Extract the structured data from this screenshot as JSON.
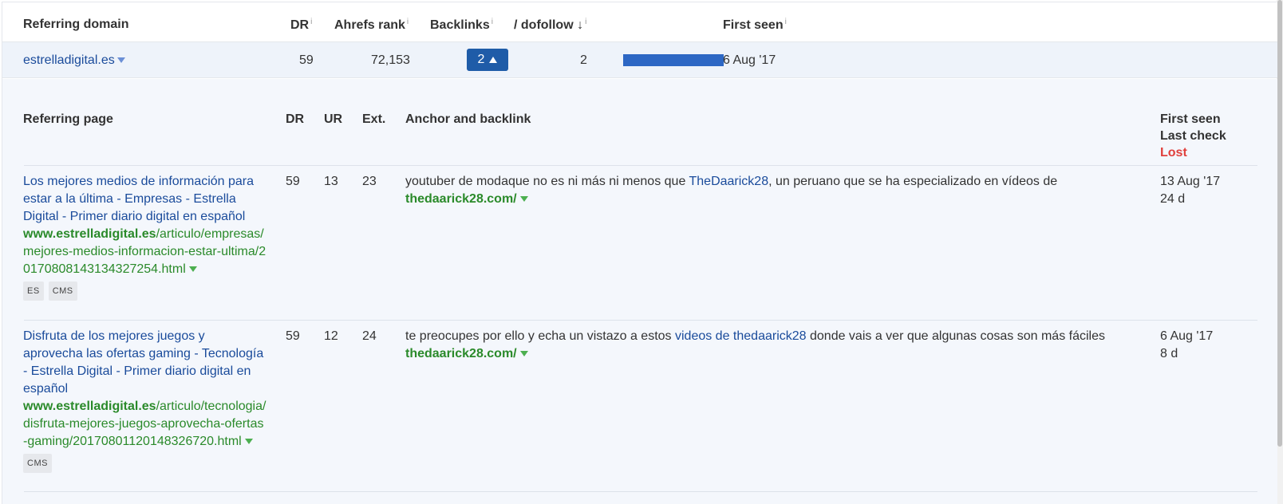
{
  "header": {
    "referring_domain": "Referring domain",
    "dr": "DR",
    "ahrefs_rank": "Ahrefs rank",
    "backlinks": "Backlinks",
    "dofollow": "/ dofollow",
    "dofollow_sort": "↓",
    "first_seen": "First seen",
    "info": "i"
  },
  "domain_row": {
    "domain": "estrelladigital.es",
    "dr": "59",
    "ahrefs_rank": "72,153",
    "backlinks": "2",
    "dofollow": "2",
    "dofollow_bar_fraction": 1.0,
    "first_seen": "6 Aug '17"
  },
  "detail_header": {
    "referring_page": "Referring page",
    "dr": "DR",
    "ur": "UR",
    "ext": "Ext.",
    "anchor": "Anchor and backlink",
    "first_seen": "First seen",
    "last_check": "Last check",
    "lost": "Lost"
  },
  "rows": [
    {
      "title": "Los mejores medios de información para estar a la última - Empresas - Estrella Digital - Primer diario digital en español",
      "url_domain": "www.estrelladigital.es",
      "url_path": "/articulo/empresas/mejores-medios-informacion-estar-ultima/20170808143134327254.html",
      "tags": [
        "ES",
        "CMS"
      ],
      "dr": "59",
      "ur": "13",
      "ext": "23",
      "anchor_before": "youtuber de modaque no es ni más ni menos que ",
      "anchor_link": "TheDaarick28",
      "anchor_after": ", un peruano que se ha especializado en vídeos de",
      "backlink": "thedaarick28.com/",
      "first_seen": "13 Aug '17",
      "last_check": "24 d"
    },
    {
      "title": "Disfruta de los mejores juegos y aprovecha las ofertas gaming - Tecnología - Estrella Digital - Primer diario digital en español",
      "url_domain": "www.estrelladigital.es",
      "url_path": "/articulo/tecnologia/disfruta-mejores-juegos-aprovecha-ofertas-gaming/20170801120148326720.html",
      "tags": [
        "CMS"
      ],
      "dr": "59",
      "ur": "12",
      "ext": "24",
      "anchor_before": "te preocupes por ello y echa un vistazo a estos ",
      "anchor_link": "videos de thedaarick28",
      "anchor_after": " donde vais a ver que algunas cosas son más fáciles",
      "backlink": "thedaarick28.com/",
      "first_seen": "6 Aug '17",
      "last_check": "8 d"
    }
  ]
}
